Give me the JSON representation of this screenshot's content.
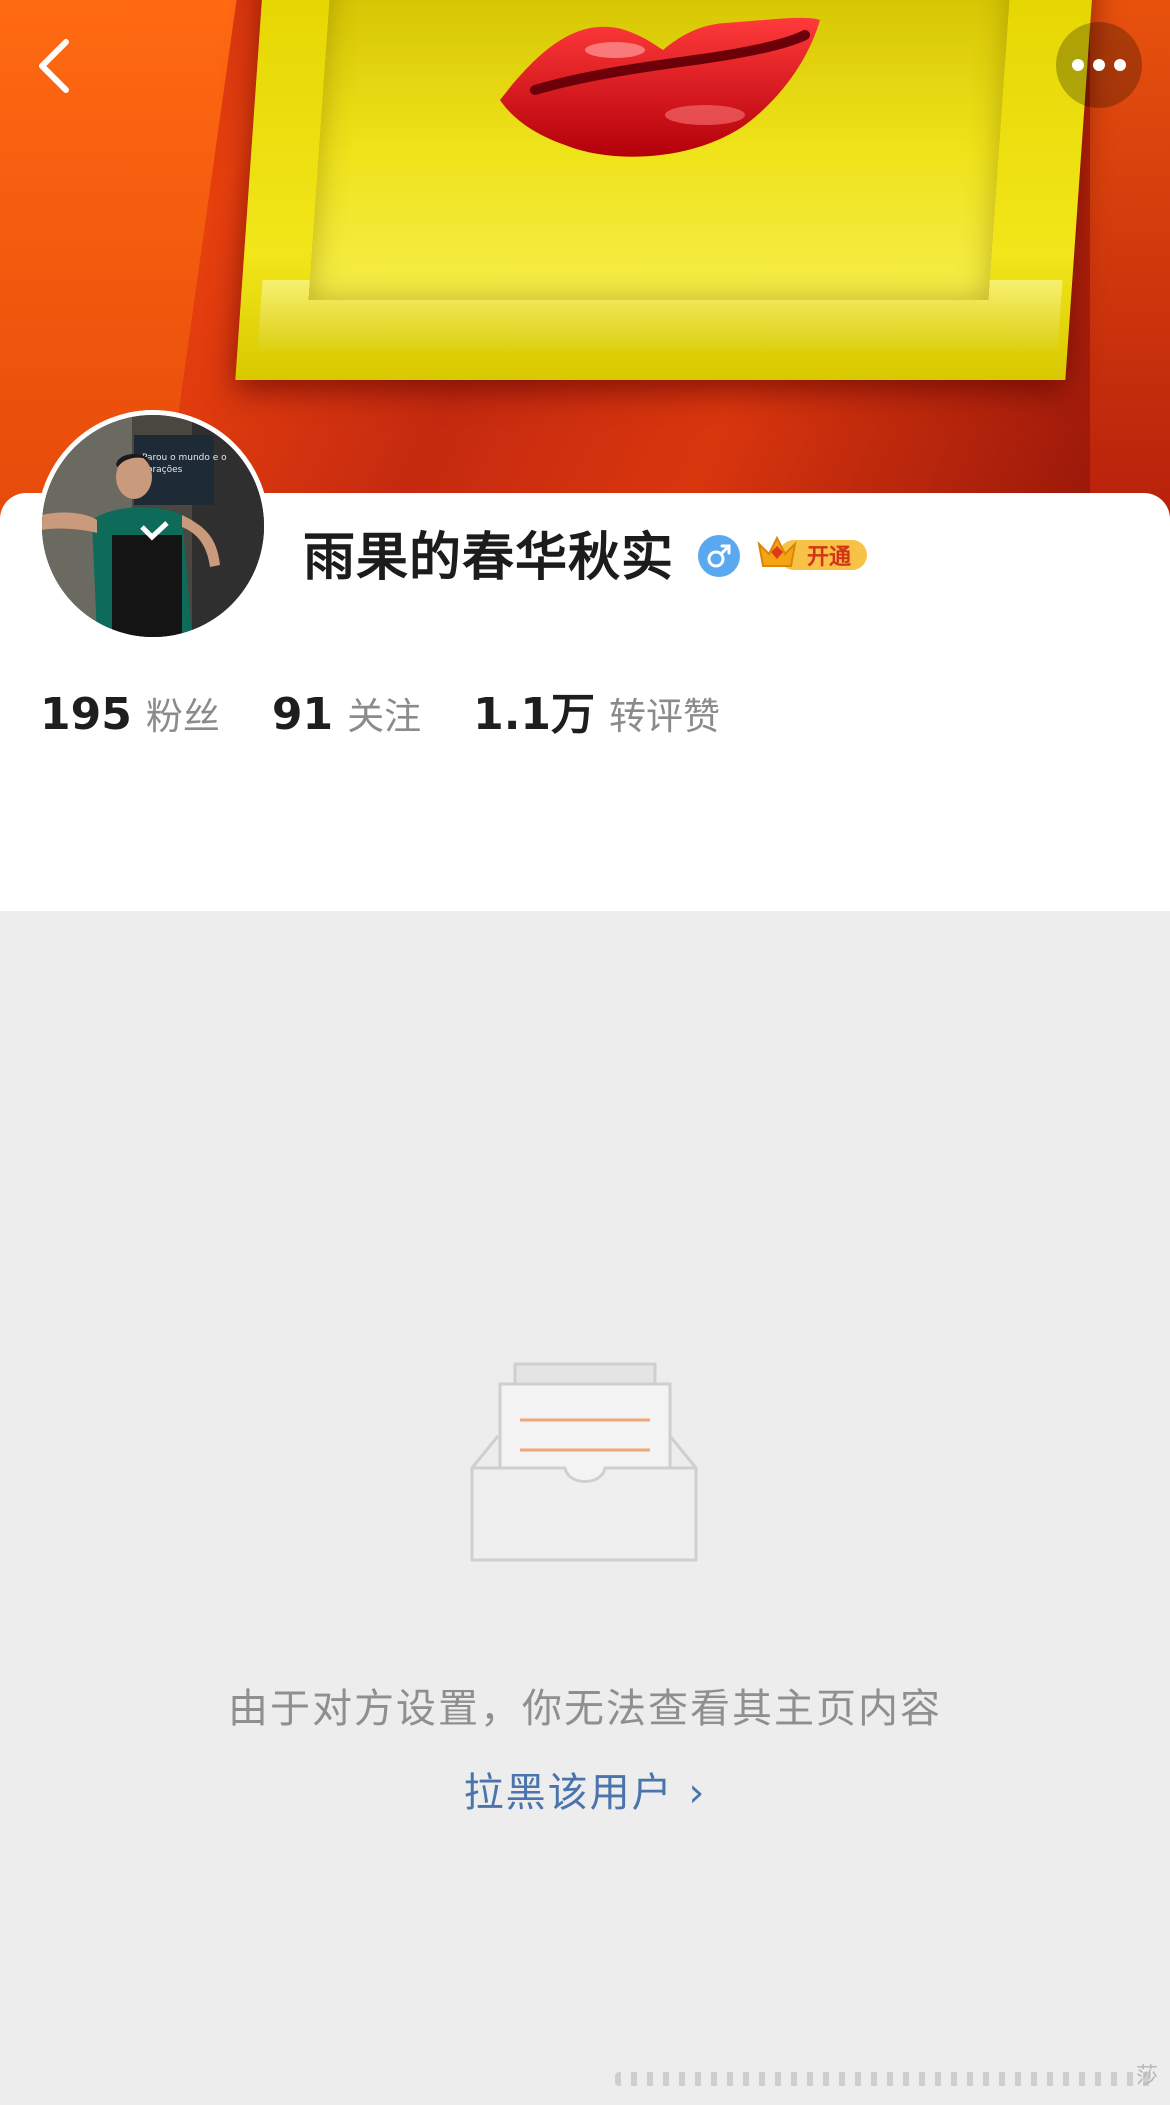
{
  "profile": {
    "name": "雨果的春华秋实",
    "gender_icon": "male-symbol",
    "vip_label": "开通"
  },
  "stats": [
    {
      "value": "195",
      "label": "粉丝"
    },
    {
      "value": "91",
      "label": "关注"
    },
    {
      "value": "1.1万",
      "label": "转评赞"
    }
  ],
  "avatar_caption": "Parou o mundo e o corações",
  "empty_state": {
    "message": "由于对方设置，你无法查看其主页内容",
    "block_link": "拉黑该用户 ›"
  },
  "watermark_char": "莎",
  "colors": {
    "link": "#4b74ad",
    "gender_badge": "#5aa8f0",
    "vip_gold": "#f5b21b",
    "vip_red": "#e03a1e"
  }
}
